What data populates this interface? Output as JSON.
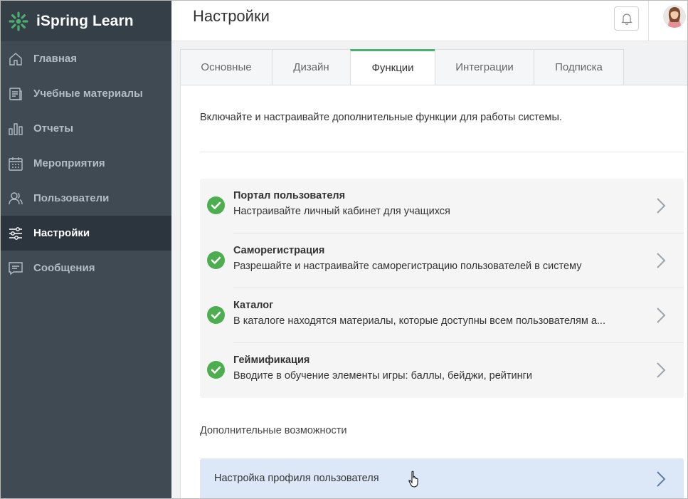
{
  "brand": {
    "name": "iSpring Learn",
    "accent": "#4cae6f"
  },
  "sidebar": {
    "items": [
      {
        "label": "Главная",
        "icon": "home-icon",
        "active": false
      },
      {
        "label": "Учебные материалы",
        "icon": "materials-icon",
        "active": false
      },
      {
        "label": "Отчеты",
        "icon": "reports-icon",
        "active": false
      },
      {
        "label": "Мероприятия",
        "icon": "calendar-icon",
        "active": false
      },
      {
        "label": "Пользователи",
        "icon": "users-icon",
        "active": false
      },
      {
        "label": "Настройки",
        "icon": "settings-sliders-icon",
        "active": true
      },
      {
        "label": "Сообщения",
        "icon": "messages-icon",
        "active": false
      }
    ]
  },
  "header": {
    "title": "Настройки"
  },
  "tabs": [
    {
      "label": "Основные",
      "active": false
    },
    {
      "label": "Дизайн",
      "active": false
    },
    {
      "label": "Функции",
      "active": true
    },
    {
      "label": "Интеграции",
      "active": false
    },
    {
      "label": "Подписка",
      "active": false
    }
  ],
  "main": {
    "intro": "Включайте и настраивайте дополнительные функции для работы системы.",
    "features": [
      {
        "title": "Портал пользователя",
        "description": "Настраивайте личный кабинет для учащихся",
        "enabled": true
      },
      {
        "title": "Саморегистрация",
        "description": "Разрешайте и настраивайте саморегистрацию пользователей в систему",
        "enabled": true
      },
      {
        "title": "Каталог",
        "description": "В каталоге находятся материалы, которые доступны всем пользователям а...",
        "enabled": true
      },
      {
        "title": "Геймификация",
        "description": "Вводите в обучение элементы игры: баллы, бейджи, рейтинги",
        "enabled": true
      }
    ],
    "extra_label": "Дополнительные возможности",
    "extra_items": [
      {
        "title": "Настройка профиля пользователя"
      }
    ]
  }
}
